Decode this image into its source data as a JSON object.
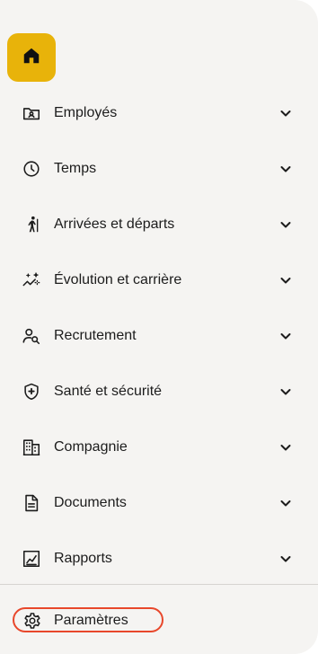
{
  "home": {
    "icon": "home-icon"
  },
  "nav": [
    {
      "label": "Employés",
      "icon": "user-folder-icon"
    },
    {
      "label": "Temps",
      "icon": "clock-icon"
    },
    {
      "label": "Arrivées et départs",
      "icon": "person-walking-icon"
    },
    {
      "label": "Évolution et carrière",
      "icon": "sparkle-trend-icon"
    },
    {
      "label": "Recrutement",
      "icon": "person-search-icon"
    },
    {
      "label": "Santé et sécurité",
      "icon": "shield-plus-icon"
    },
    {
      "label": "Compagnie",
      "icon": "building-icon"
    },
    {
      "label": "Documents",
      "icon": "document-icon"
    },
    {
      "label": "Rapports",
      "icon": "chart-icon"
    }
  ],
  "settings": {
    "label": "Paramètres",
    "icon": "gear-icon",
    "highlight_color": "#e8472b"
  },
  "colors": {
    "accent": "#e8b30a",
    "background": "#f5f4f2",
    "text": "#1c1c1c"
  }
}
